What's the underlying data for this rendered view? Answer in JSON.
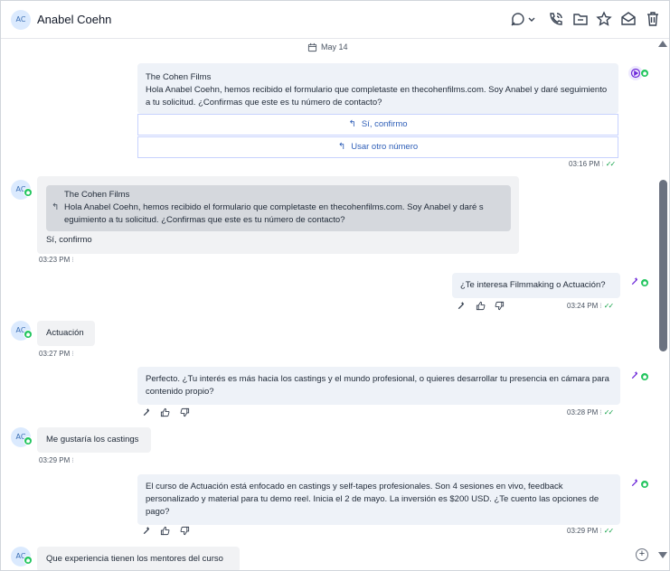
{
  "header": {
    "avatar_initials": "AC",
    "contact_name": "Anabel Coehn",
    "icons": [
      "assign-icon",
      "chevron-down-icon",
      "phone-call-icon",
      "folder-icon",
      "star-icon",
      "mail-open-icon",
      "trash-icon"
    ]
  },
  "date_separator": "May 14",
  "messages": [
    {
      "direction": "outgoing",
      "sender": "The Cohen Films",
      "text": "Hola Anabel Coehn, hemos recibido el formulario que completaste en thecohenfilms.com. Soy Anabel y daré seguimiento a tu solicitud. ¿Confirmas que este es tu número de contacto?",
      "buttons": [
        "Sí, confirmo",
        "Usar otro número"
      ],
      "time": "03:16 PM"
    },
    {
      "direction": "incoming",
      "avatar_initials": "AC",
      "quote_sender": "The Cohen Films",
      "quote_text": "Hola Anabel Coehn, hemos recibido el formulario que completaste en thecohenfilms.com. Soy Anabel y daré s eguimiento a tu solicitud. ¿Confirmas que este es tu número de contacto?",
      "text": "Sí, confirmo",
      "time": "03:23 PM"
    },
    {
      "direction": "outgoing",
      "text": "¿Te interesa Filmmaking o Actuación?",
      "time": "03:24 PM"
    },
    {
      "direction": "incoming",
      "avatar_initials": "AC",
      "text": "Actuación",
      "time": "03:27 PM"
    },
    {
      "direction": "outgoing",
      "text": "Perfecto. ¿Tu interés es más hacia los castings y el mundo profesional, o quieres desarrollar tu presencia en cámara para contenido propio?",
      "time": "03:28 PM"
    },
    {
      "direction": "incoming",
      "avatar_initials": "AC",
      "text": "Me gustaría los castings",
      "time": "03:29 PM"
    },
    {
      "direction": "outgoing",
      "text": "El curso de Actuación está enfocado en castings y self-tapes profesionales. Son 4 sesiones en vivo, feedback personalizado y material para tu demo reel. Inicia el 2 de mayo. La inversión es $200 USD. ¿Te cuento las opciones de pago?",
      "time": "03:29 PM"
    },
    {
      "direction": "incoming",
      "avatar_initials": "AC",
      "text": "Que experiencia tienen los mentores del curso"
    }
  ],
  "colors": {
    "outgoing_bubble": "#eef2f8",
    "incoming_bubble": "#f1f2f4",
    "reply_button_text": "#2f5fb8",
    "whatsapp_green": "#22c55e",
    "ai_purple": "#6d28d9"
  }
}
